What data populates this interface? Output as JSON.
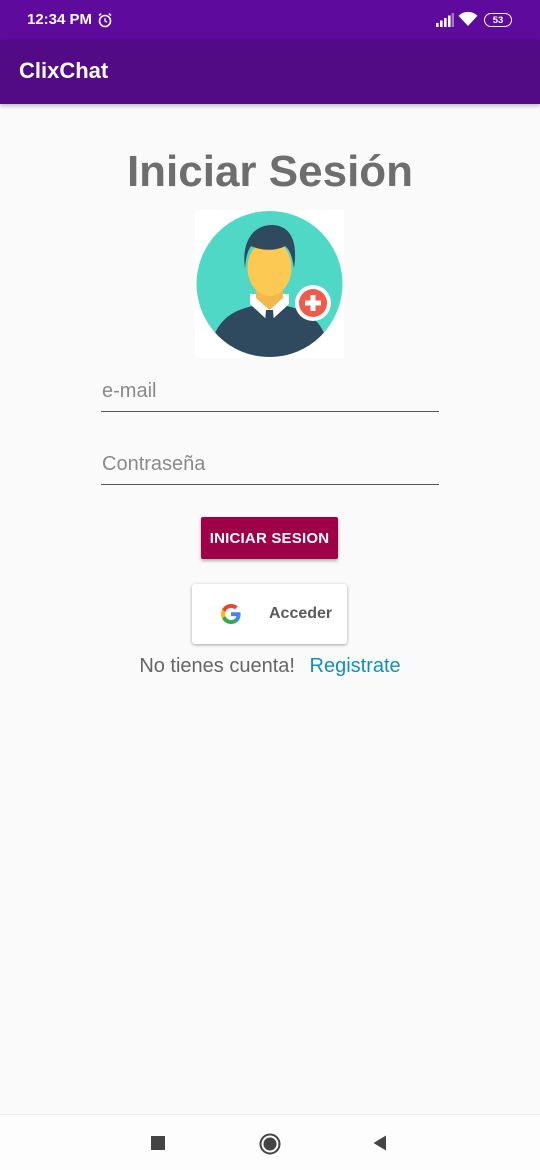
{
  "status_bar": {
    "time": "12:34 PM",
    "battery": "53",
    "icons": [
      "alarm-icon",
      "signal-icon",
      "wifi-icon",
      "battery-icon"
    ]
  },
  "app_bar": {
    "title": "ClixChat"
  },
  "colors": {
    "status_bar": "#5e0a9c",
    "app_bar": "#520a85",
    "title_text": "#6e6e6e",
    "login_button": "#a00048",
    "link": "#1190b9",
    "avatar_circle": "#4fd8c5"
  },
  "login": {
    "title": "Iniciar Sesión",
    "avatar_icon": "user-add-avatar-icon",
    "email_placeholder": "e-mail",
    "email_value": "",
    "password_placeholder": "Contraseña",
    "password_value": "",
    "login_button_label": "INICIAR SESION",
    "google_button_label": "Acceder",
    "register_prompt": "No tienes cuenta!",
    "register_link": "Registrate"
  },
  "nav_bar": {
    "icons": [
      "recents-square-icon",
      "home-circle-icon",
      "back-triangle-icon"
    ]
  }
}
